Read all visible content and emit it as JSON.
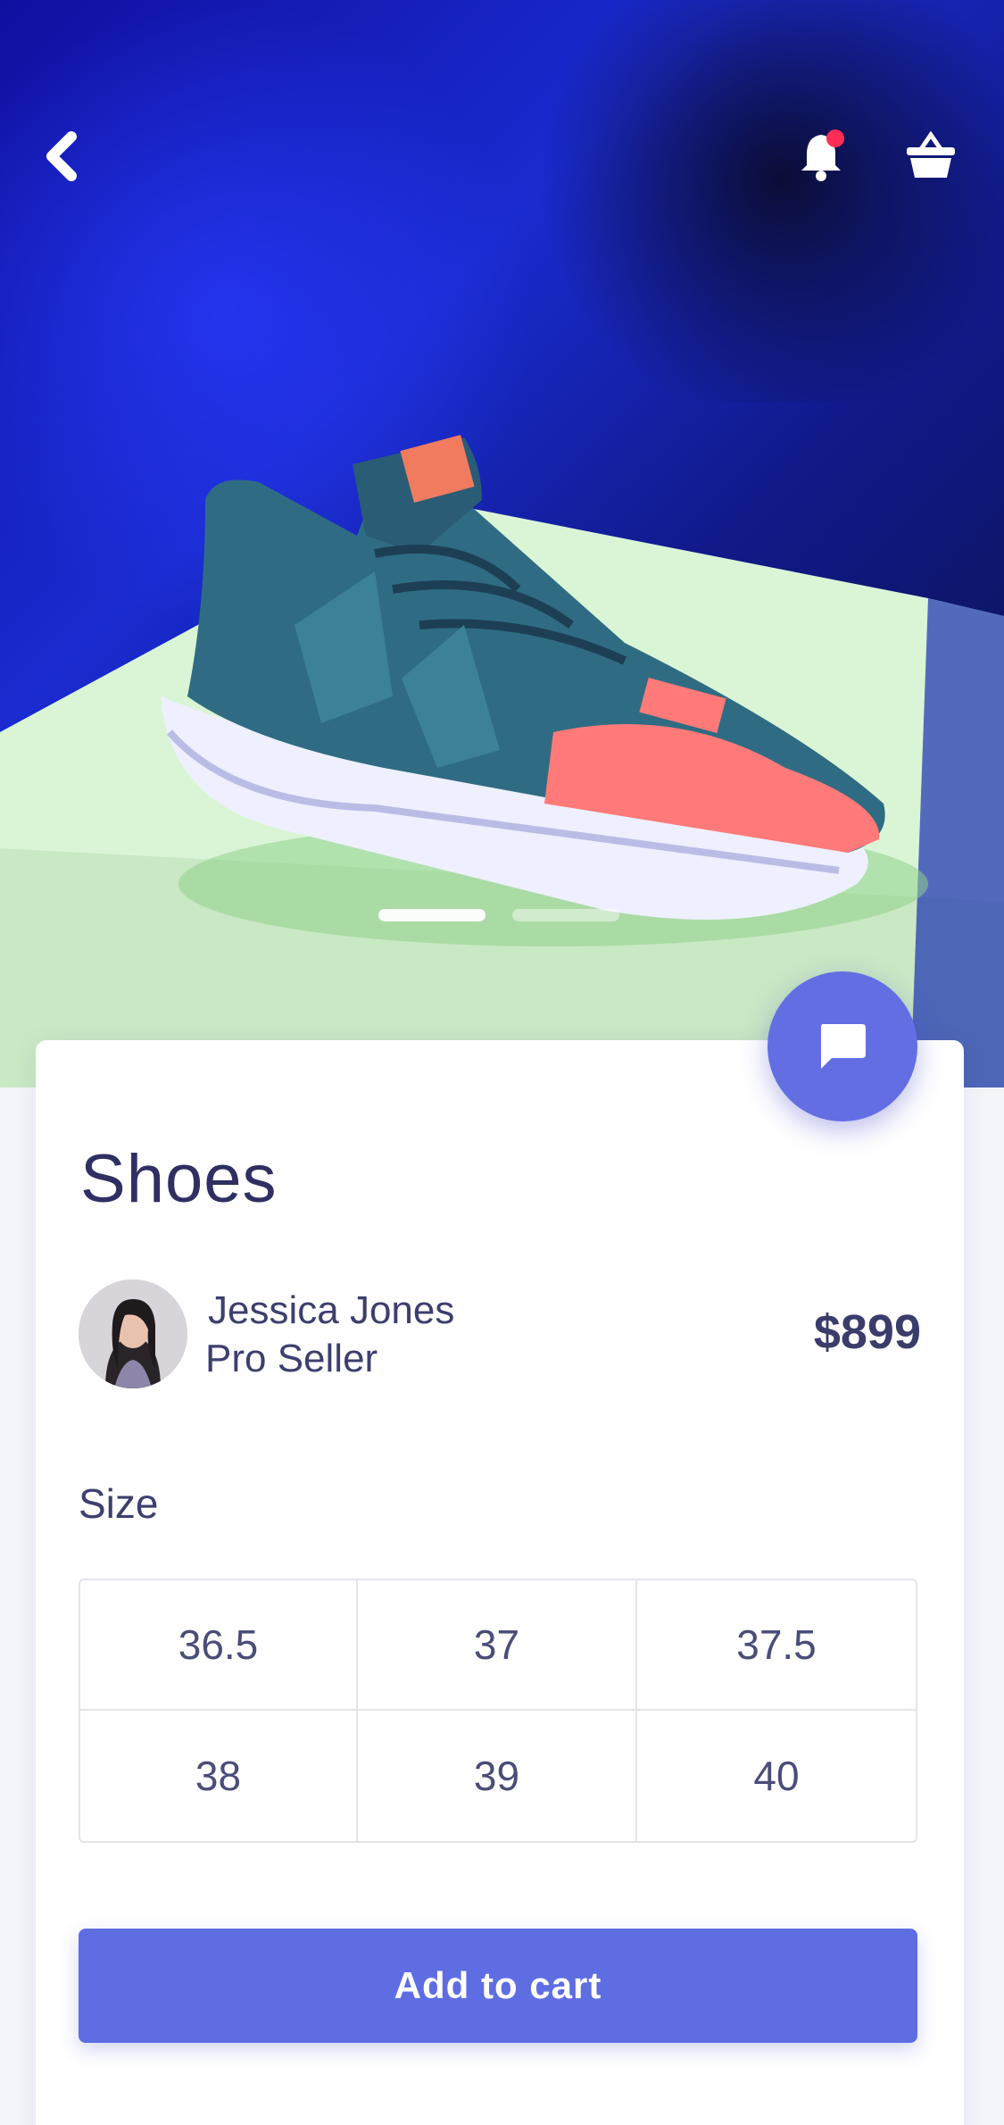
{
  "product": {
    "title": "Shoes",
    "price": "$899",
    "image_slide_count": 2,
    "active_slide": 1
  },
  "seller": {
    "name": "Jessica Jones",
    "role": "Pro Seller"
  },
  "size": {
    "label": "Size",
    "options": [
      "36.5",
      "37",
      "37.5",
      "38",
      "39",
      "40"
    ]
  },
  "actions": {
    "add_to_cart": "Add to cart"
  },
  "icons": {
    "back": "chevron-left-icon",
    "notifications": "bell-icon",
    "cart": "basket-icon",
    "chat": "chat-bubble-icon"
  },
  "colors": {
    "accent": "#5f6de3",
    "text_dark": "#2f2f63",
    "notification_dot": "#ff2d55",
    "background": "#f4f5fb"
  }
}
